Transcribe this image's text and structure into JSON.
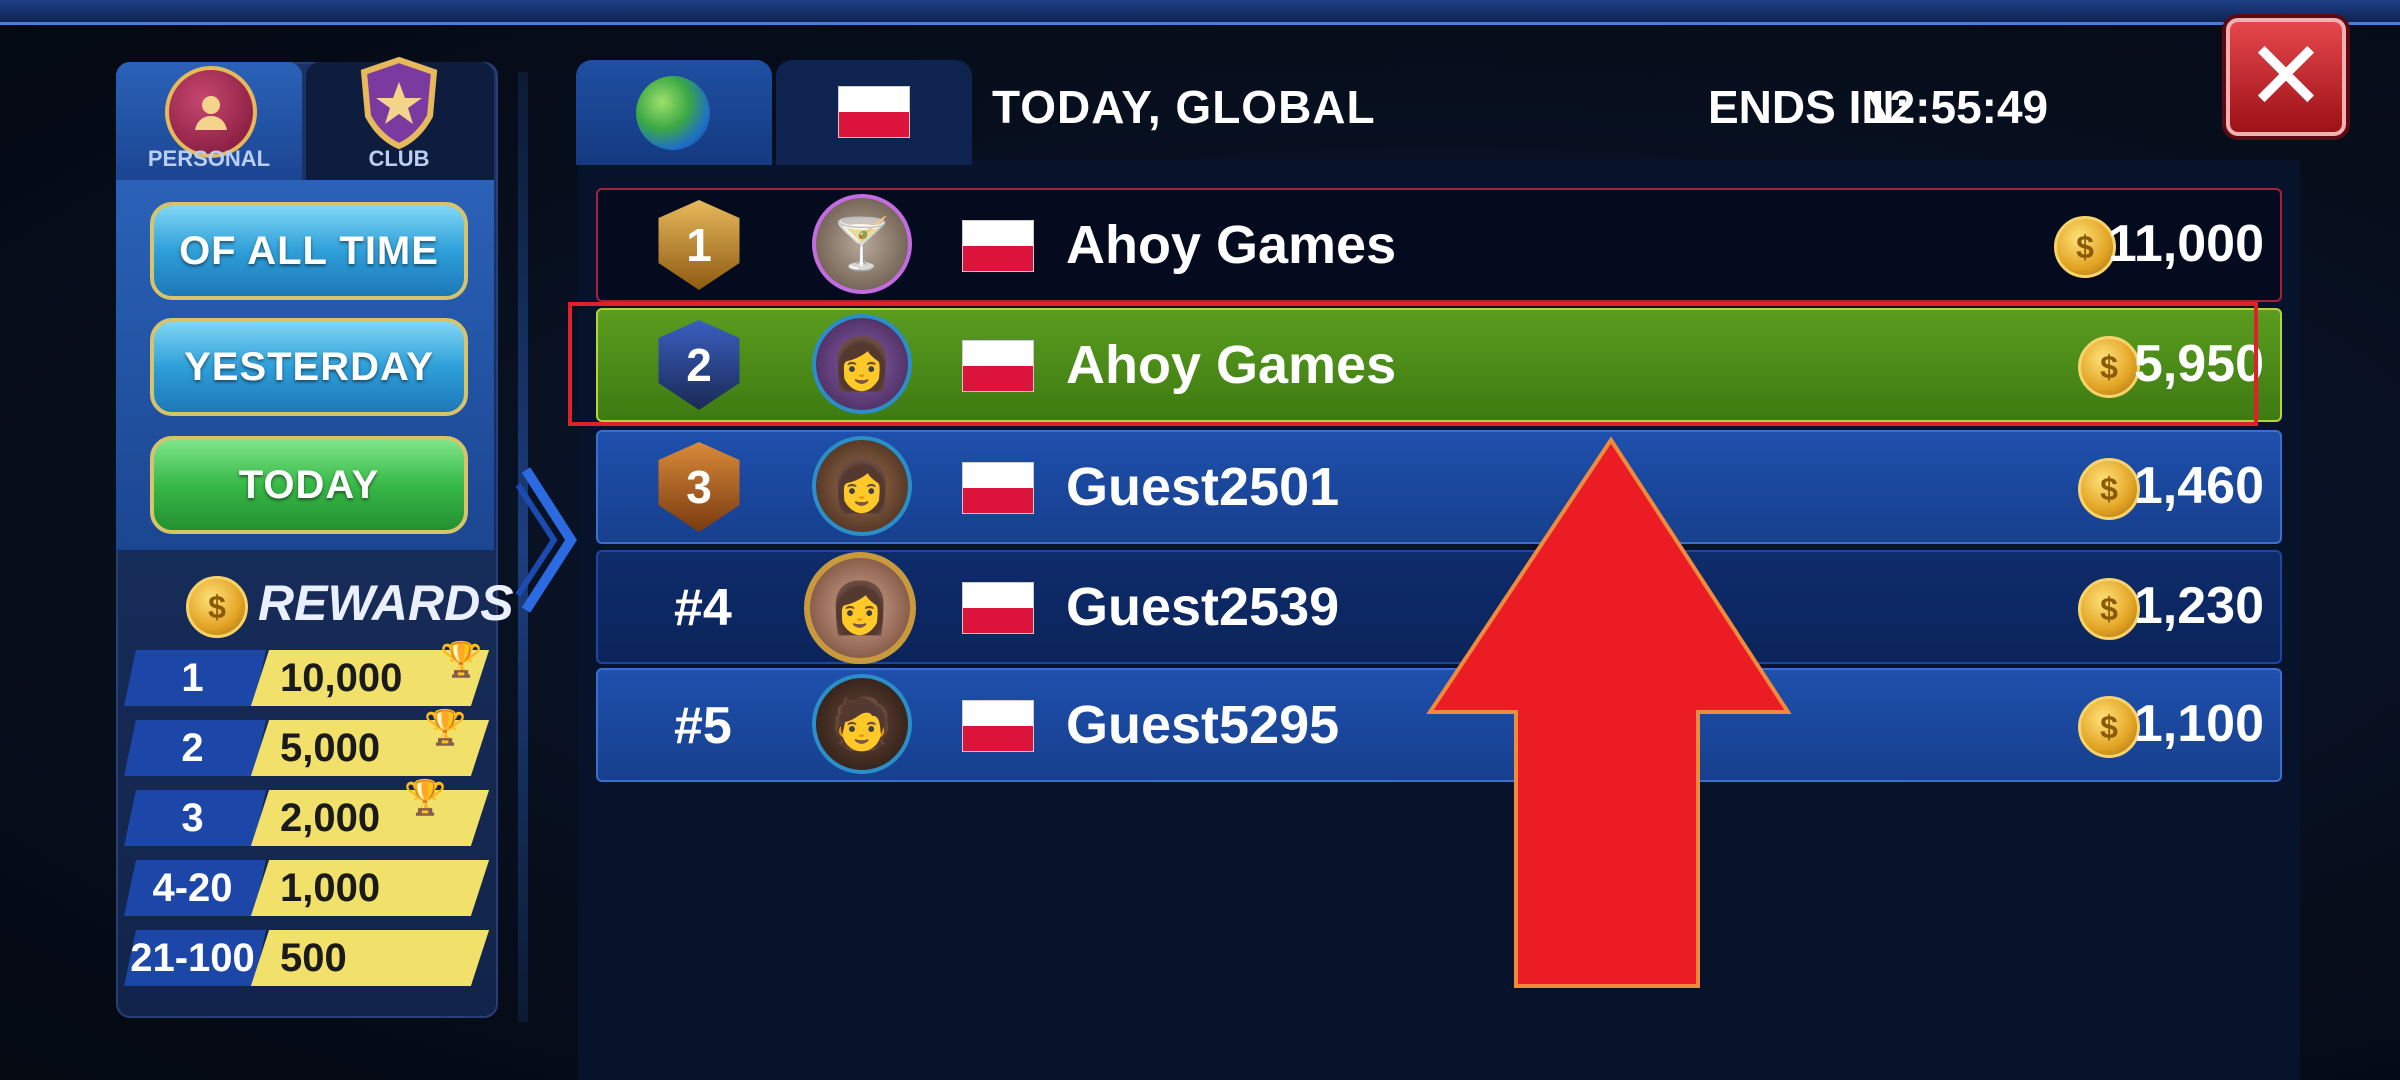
{
  "window": {
    "close_label": "✕"
  },
  "left_tabs": [
    {
      "label": "PERSONAL",
      "icon": "person-icon"
    },
    {
      "label": "CLUB",
      "icon": "shield-star-icon"
    }
  ],
  "periods": [
    {
      "label": "OF ALL TIME"
    },
    {
      "label": "YESTERDAY"
    },
    {
      "label": "TODAY",
      "active": true
    }
  ],
  "rewards": {
    "title": "REWARDS",
    "tiers": [
      {
        "rank": "1",
        "amount": "10,000"
      },
      {
        "rank": "2",
        "amount": "5,000"
      },
      {
        "rank": "3",
        "amount": "2,000"
      },
      {
        "rank": "4-20",
        "amount": "1,000"
      },
      {
        "rank": "21-100",
        "amount": "500"
      }
    ]
  },
  "header": {
    "title": "TODAY, GLOBAL",
    "ends_label": "ENDS IN:",
    "ends_time": "12:55:49"
  },
  "leaderboard": [
    {
      "rank": "1",
      "name": "Ahoy Games",
      "score": "11,000"
    },
    {
      "rank": "2",
      "name": "Ahoy Games",
      "score": "5,950"
    },
    {
      "rank": "3",
      "name": "Guest2501",
      "score": "1,460"
    },
    {
      "rank": "#4",
      "name": "Guest2539",
      "score": "1,230"
    },
    {
      "rank": "#5",
      "name": "Guest5295",
      "score": "1,100"
    }
  ],
  "colors": {
    "accent": "#2e5fc0",
    "highlight": "#e0202a",
    "arrow": "#ec1c24",
    "current_row": "#4c8c18"
  }
}
